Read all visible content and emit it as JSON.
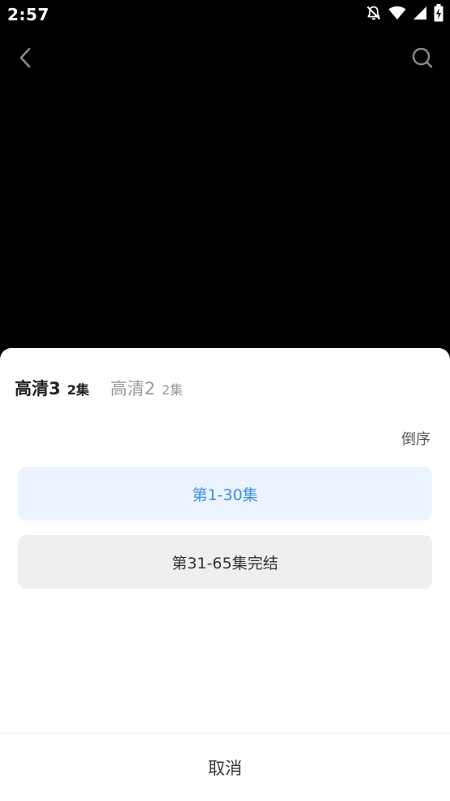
{
  "status_bar": {
    "time": "2:57",
    "icons": [
      "bell-off-icon",
      "wifi-icon",
      "cellular-signal-icon",
      "battery-charging-icon"
    ]
  },
  "nav": {
    "back_icon": "chevron-left-icon",
    "search_icon": "search-icon"
  },
  "sheet": {
    "sources": [
      {
        "name": "高清3",
        "count": "2集",
        "active": true
      },
      {
        "name": "高清2",
        "count": "2集",
        "active": false
      }
    ],
    "sort_label": "倒序",
    "ranges": [
      {
        "label": "第1-30集",
        "selected": true
      },
      {
        "label": "第31-65集完结",
        "selected": false
      }
    ],
    "cancel_label": "取消"
  },
  "colors": {
    "accent": "#3f8fe6",
    "selected_bg": "#ebf3fe",
    "normal_bg": "#efefef"
  }
}
